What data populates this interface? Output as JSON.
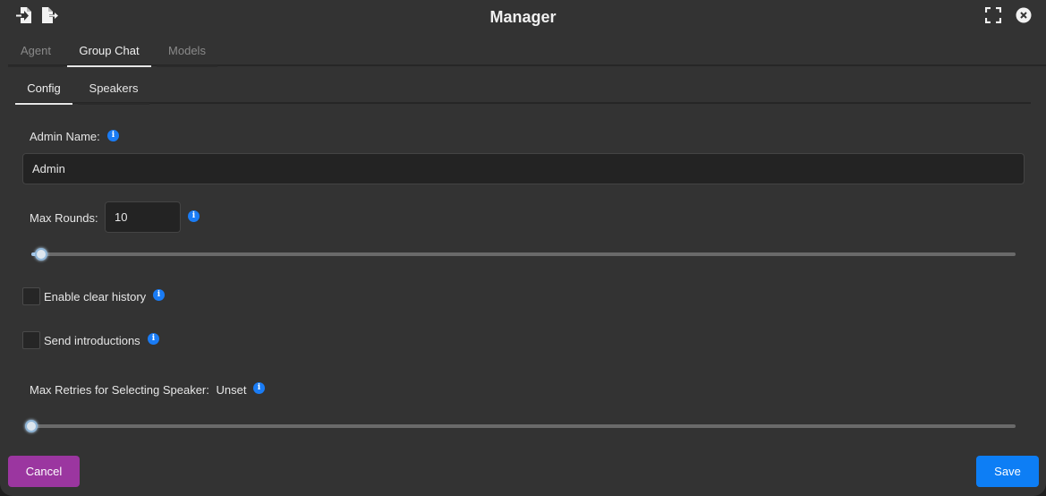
{
  "window": {
    "title": "Manager",
    "header_icons": {
      "left": [
        "file-import-icon",
        "file-export-icon"
      ],
      "right": [
        "fullscreen-icon",
        "close-icon"
      ]
    }
  },
  "tabs_top": [
    {
      "label": "Agent",
      "active": false
    },
    {
      "label": "Group Chat",
      "active": true
    },
    {
      "label": "Models",
      "active": false
    }
  ],
  "tabs_inner": [
    {
      "label": "Config",
      "active": true
    },
    {
      "label": "Speakers",
      "active": false
    }
  ],
  "config": {
    "admin_name": {
      "label": "Admin Name:",
      "value": "Admin",
      "info_icon": "info-icon"
    },
    "max_rounds": {
      "label": "Max Rounds:",
      "value": "10",
      "info_icon": "info-icon",
      "slider_fraction": 0.01
    },
    "enable_clear_history": {
      "label": "Enable clear history",
      "checked": false,
      "info_icon": "info-icon"
    },
    "send_introductions": {
      "label": "Send introductions",
      "checked": false,
      "info_icon": "info-icon"
    },
    "max_retries": {
      "label": "Max Retries for Selecting Speaker:",
      "value": "Unset",
      "info_icon": "info-icon",
      "slider_fraction": 0.0
    }
  },
  "footer": {
    "cancel_label": "Cancel",
    "save_label": "Save"
  },
  "colors": {
    "accent_info": "#1a7cf5",
    "cancel_button": "#9b36a0",
    "save_button": "#0d7ef5",
    "background": "#333333"
  }
}
